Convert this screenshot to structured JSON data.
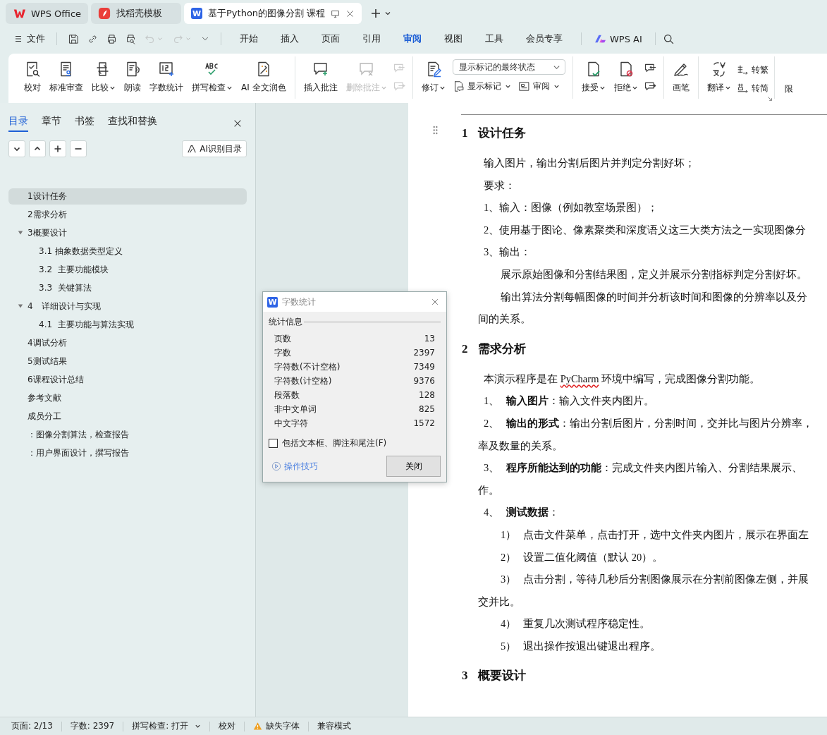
{
  "tab_bar": {
    "tabs": [
      {
        "label": "WPS Office",
        "kind": "wps",
        "selected": false
      },
      {
        "label": "找稻壳模板",
        "kind": "docer",
        "selected": false
      },
      {
        "label": "基于Python的图像分割 课程",
        "kind": "writer",
        "logo_text": "W",
        "selected": true
      }
    ]
  },
  "menu_bar": {
    "file_label": "文件",
    "quick_tools": [
      {
        "kind": "save",
        "disabled": false
      },
      {
        "kind": "link",
        "disabled": false
      },
      {
        "kind": "print",
        "disabled": false
      },
      {
        "kind": "preview",
        "disabled": false
      },
      {
        "kind": "undo",
        "disabled": true
      },
      {
        "kind": "redo",
        "disabled": true
      },
      {
        "kind": "more",
        "disabled": false
      }
    ],
    "tabs": [
      {
        "label": "开始",
        "selected": false
      },
      {
        "label": "插入",
        "selected": false
      },
      {
        "label": "页面",
        "selected": false
      },
      {
        "label": "引用",
        "selected": false
      },
      {
        "label": "审阅",
        "selected": true
      },
      {
        "label": "视图",
        "selected": false
      },
      {
        "label": "工具",
        "selected": false
      },
      {
        "label": "会员专享",
        "selected": false
      }
    ],
    "ai_label": "WPS AI"
  },
  "ribbon": {
    "groups": [
      {
        "items": [
          {
            "kind": "big",
            "label": "校对",
            "dropdown": false,
            "disabled": false
          },
          {
            "kind": "big",
            "label": "标准审查",
            "dropdown": false,
            "disabled": false
          },
          {
            "kind": "big",
            "label": "比较",
            "dropdown": true,
            "disabled": false
          },
          {
            "kind": "big",
            "label": "朗读",
            "dropdown": false,
            "disabled": false
          },
          {
            "kind": "big",
            "label": "字数统计",
            "dropdown": false,
            "disabled": false
          },
          {
            "kind": "big",
            "label": "拼写检查",
            "dropdown": true,
            "disabled": false
          },
          {
            "kind": "big",
            "label": "AI 全文润色",
            "dropdown": false,
            "disabled": false
          }
        ]
      },
      {
        "items": [
          {
            "kind": "big",
            "label": "插入批注",
            "dropdown": false,
            "disabled": false
          },
          {
            "kind": "big",
            "label": "删除批注",
            "dropdown": true,
            "disabled": true
          },
          {
            "kind": "icon_stack",
            "disabled": true
          }
        ]
      },
      {
        "items": [
          {
            "kind": "big",
            "label": "修订",
            "dropdown": true,
            "disabled": false
          },
          {
            "kind": "field_stack",
            "field": {
              "value": "显示标记的最终状态"
            },
            "buttons": [
              {
                "label": "显示标记",
                "dropdown": true
              },
              {
                "label": "审阅",
                "dropdown": true
              }
            ]
          }
        ]
      },
      {
        "items": [
          {
            "kind": "big",
            "label": "接受",
            "dropdown": true,
            "disabled": false
          },
          {
            "kind": "big",
            "label": "拒绝",
            "dropdown": true,
            "disabled": false
          },
          {
            "kind": "icon_stack",
            "disabled": false
          }
        ]
      },
      {
        "items": [
          {
            "kind": "big",
            "label": "画笔",
            "dropdown": false,
            "disabled": false
          }
        ]
      },
      {
        "launcher": true,
        "items": [
          {
            "kind": "big",
            "label": "翻译",
            "dropdown": true,
            "disabled": false
          },
          {
            "kind": "small_stack",
            "buttons": [
              {
                "label": "转繁",
                "dropdown": false
              },
              {
                "label": "转简",
                "dropdown": false
              }
            ]
          }
        ]
      },
      {
        "items": [
          {
            "kind": "label_only",
            "label": "限"
          }
        ]
      }
    ]
  },
  "nav_panel": {
    "tabs": [
      {
        "label": "目录",
        "selected": true
      },
      {
        "label": "章节",
        "selected": false
      },
      {
        "label": "书签",
        "selected": false
      },
      {
        "label": "查找和替换",
        "selected": false
      }
    ],
    "ai_button": "AI识别目录",
    "toc": [
      {
        "label": "1设计任务",
        "selected": true
      },
      {
        "label": "2需求分析",
        "selected": false
      },
      {
        "label": "3概要设计",
        "selected": false,
        "expanded": true,
        "children": [
          {
            "label": "3.1 抽象数据类型定义",
            "selected": false
          },
          {
            "label": "3.2  主要功能模块",
            "selected": false
          },
          {
            "label": "3.3  关键算法",
            "selected": false
          }
        ]
      },
      {
        "label": "4　详细设计与实现",
        "selected": false,
        "expanded": true,
        "children": [
          {
            "label": "4.1  主要功能与算法实现",
            "selected": false
          }
        ]
      },
      {
        "label": "4调试分析",
        "selected": false
      },
      {
        "label": "5测试结果",
        "selected": false
      },
      {
        "label": "6课程设计总结",
        "selected": false
      },
      {
        "label": "参考文献",
        "selected": false
      },
      {
        "label": "成员分工",
        "selected": false
      },
      {
        "label": "：图像分割算法，检查报告",
        "selected": false
      },
      {
        "label": "：用户界面设计，撰写报告",
        "selected": false
      }
    ]
  },
  "document": {
    "blocks": [
      {
        "kind": "heading",
        "number": "1",
        "text": "设计任务"
      },
      {
        "kind": "para",
        "text": "输入图片，输出分割后图片并判定分割好坏；"
      },
      {
        "kind": "para",
        "text": "要求："
      },
      {
        "kind": "para",
        "text": "1、输入：图像（例如教室场景图）；"
      },
      {
        "kind": "para",
        "text": "2、使用基于图论、像素聚类和深度语义这三大类方法之一实现图像分"
      },
      {
        "kind": "para",
        "text": "3、输出："
      },
      {
        "kind": "sub",
        "text": "展示原始图像和分割结果图，定义并展示分割指标判定分割好坏。"
      },
      {
        "kind": "sub",
        "text": "输出算法分割每幅图像的时间并分析该时间和图像的分辨率以及分"
      },
      {
        "kind": "flush",
        "text": "间的关系。"
      },
      {
        "kind": "heading",
        "number": "2",
        "text": "需求分析"
      },
      {
        "kind": "para",
        "text": "本演示程序是在 ",
        "flagged": "PyCharm",
        "text_after": " 环境中编写，完成图像分割功能。"
      },
      {
        "kind": "item",
        "number": "1、",
        "text": "**输入图片**：输入文件夹内图片。"
      },
      {
        "kind": "item",
        "number": "2、",
        "text": "**输出的形式**：输出分割后图片，分割时间，交并比与图片分辨率，"
      },
      {
        "kind": "flush",
        "text": "率及数量的关系。"
      },
      {
        "kind": "item",
        "number": "3、",
        "text": "**程序所能达到的功能**：完成文件夹内图片输入、分割结果展示、"
      },
      {
        "kind": "flush",
        "text": "作。"
      },
      {
        "kind": "item",
        "number": "4、",
        "text": "**测试数据**："
      },
      {
        "kind": "step",
        "number": "1）",
        "text": "点击文件菜单，点击打开，选中文件夹内图片，展示在界面左"
      },
      {
        "kind": "step",
        "number": "2）",
        "text": "设置二值化阈值（默认 20）。"
      },
      {
        "kind": "step",
        "number": "3）",
        "text": "点击分割，等待几秒后分割图像展示在分割前图像左侧，并展"
      },
      {
        "kind": "flush",
        "text": "交并比。"
      },
      {
        "kind": "step",
        "number": "4）",
        "text": "重复几次测试程序稳定性。"
      },
      {
        "kind": "step",
        "number": "5）",
        "text": "退出操作按退出键退出程序。"
      },
      {
        "kind": "heading",
        "number": "3",
        "text": "概要设计"
      }
    ]
  },
  "word_count_dialog": {
    "logo_text": "W",
    "title": "字数统计",
    "section": "统计信息",
    "rows": [
      {
        "label": "页数",
        "value": "13"
      },
      {
        "label": "字数",
        "value": "2397"
      },
      {
        "label": "字符数(不计空格)",
        "value": "7349"
      },
      {
        "label": "字符数(计空格)",
        "value": "9376"
      },
      {
        "label": "段落数",
        "value": "128"
      },
      {
        "label": "非中文单词",
        "value": "825"
      },
      {
        "label": "中文字符",
        "value": "1572"
      }
    ],
    "checkbox": {
      "label": "包括文本框、脚注和尾注(F)",
      "checked": false
    },
    "tips_link": "操作技巧",
    "close_button": "关闭"
  },
  "status_bar": {
    "items": [
      {
        "kind": "text",
        "label": "页面: 2/13"
      },
      {
        "kind": "text",
        "label": "字数: 2397"
      },
      {
        "kind": "dropdown",
        "label": "拼写检查: 打开"
      },
      {
        "kind": "text",
        "label": "校对"
      },
      {
        "kind": "warning",
        "label": "缺失字体"
      },
      {
        "kind": "text",
        "label": "兼容模式"
      }
    ]
  }
}
